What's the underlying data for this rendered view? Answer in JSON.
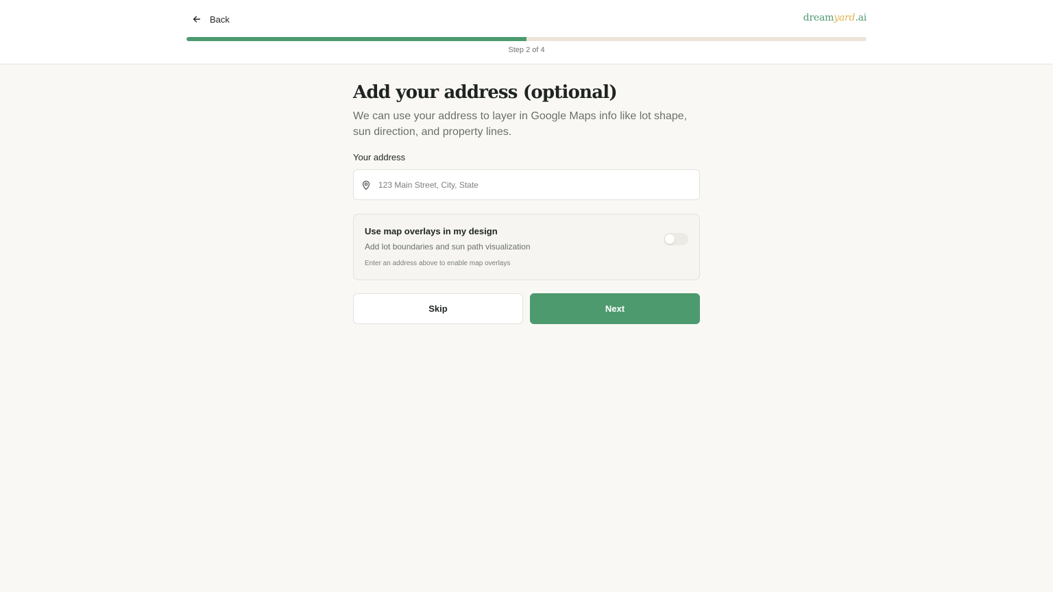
{
  "header": {
    "back_label": "Back",
    "logo": {
      "part1": "dream",
      "part2": "yard",
      "part3": ".ai"
    },
    "progress": {
      "fraction": 0.5,
      "step_text": "Step 2 of 4"
    }
  },
  "main": {
    "title": "Add your address (optional)",
    "subtitle": "We can use your address to layer in Google Maps info like lot shape, sun direction, and property lines.",
    "address_label": "Your address",
    "address_value": "",
    "address_placeholder": "123 Main Street, City, State"
  },
  "overlay_card": {
    "title": "Use map overlays in my design",
    "description": "Add lot boundaries and sun path visualization",
    "hint": "Enter an address above to enable map overlays",
    "toggle_on": false
  },
  "actions": {
    "skip_label": "Skip",
    "next_label": "Next"
  },
  "colors": {
    "accent": "#4e9a6f",
    "logo_accent": "#e0b24f",
    "progress_track": "#ece4d8",
    "background": "#f9f8f5"
  },
  "icons": {
    "back": "arrow-left-icon",
    "address": "map-pin-icon"
  }
}
